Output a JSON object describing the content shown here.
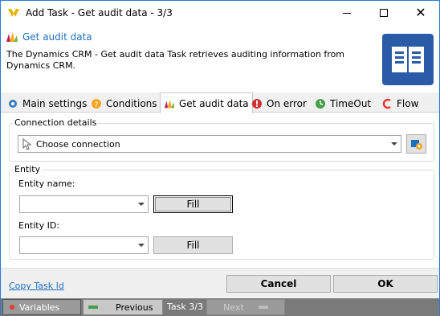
{
  "window": {
    "title": "Add Task - Get audit data - 3/3"
  },
  "header": {
    "title": "Get audit data",
    "description": "The Dynamics CRM - Get audit data Task retrieves auditing information from Dynamics CRM."
  },
  "tabs": [
    {
      "label": "Main settings",
      "icon": "gear-icon"
    },
    {
      "label": "Conditions",
      "icon": "conditions-icon"
    },
    {
      "label": "Get audit data",
      "icon": "dynamics-crm-icon"
    },
    {
      "label": "On error",
      "icon": "error-icon"
    },
    {
      "label": "TimeOut",
      "icon": "timeout-icon"
    },
    {
      "label": "Flow",
      "icon": "flow-icon"
    }
  ],
  "connection": {
    "group_label": "Connection details",
    "value": "Choose connection"
  },
  "entity": {
    "group_label": "Entity",
    "name_label": "Entity name:",
    "name_value": "",
    "id_label": "Entity ID:",
    "id_value": "",
    "fill_label": "Fill"
  },
  "footer": {
    "copy_link": "Copy Task Id",
    "cancel_label": "Cancel",
    "ok_label": "OK"
  },
  "statusbar": {
    "variables_label": "Variables",
    "previous_label": "Previous",
    "task_label": "Task 3/3",
    "next_label": "Next"
  },
  "colors": {
    "accent": "#1f6fbf",
    "window_border": "#2b79d8",
    "header_icon_bg": "#2a5aa8",
    "statusbar_bg": "#7a7a7a"
  }
}
